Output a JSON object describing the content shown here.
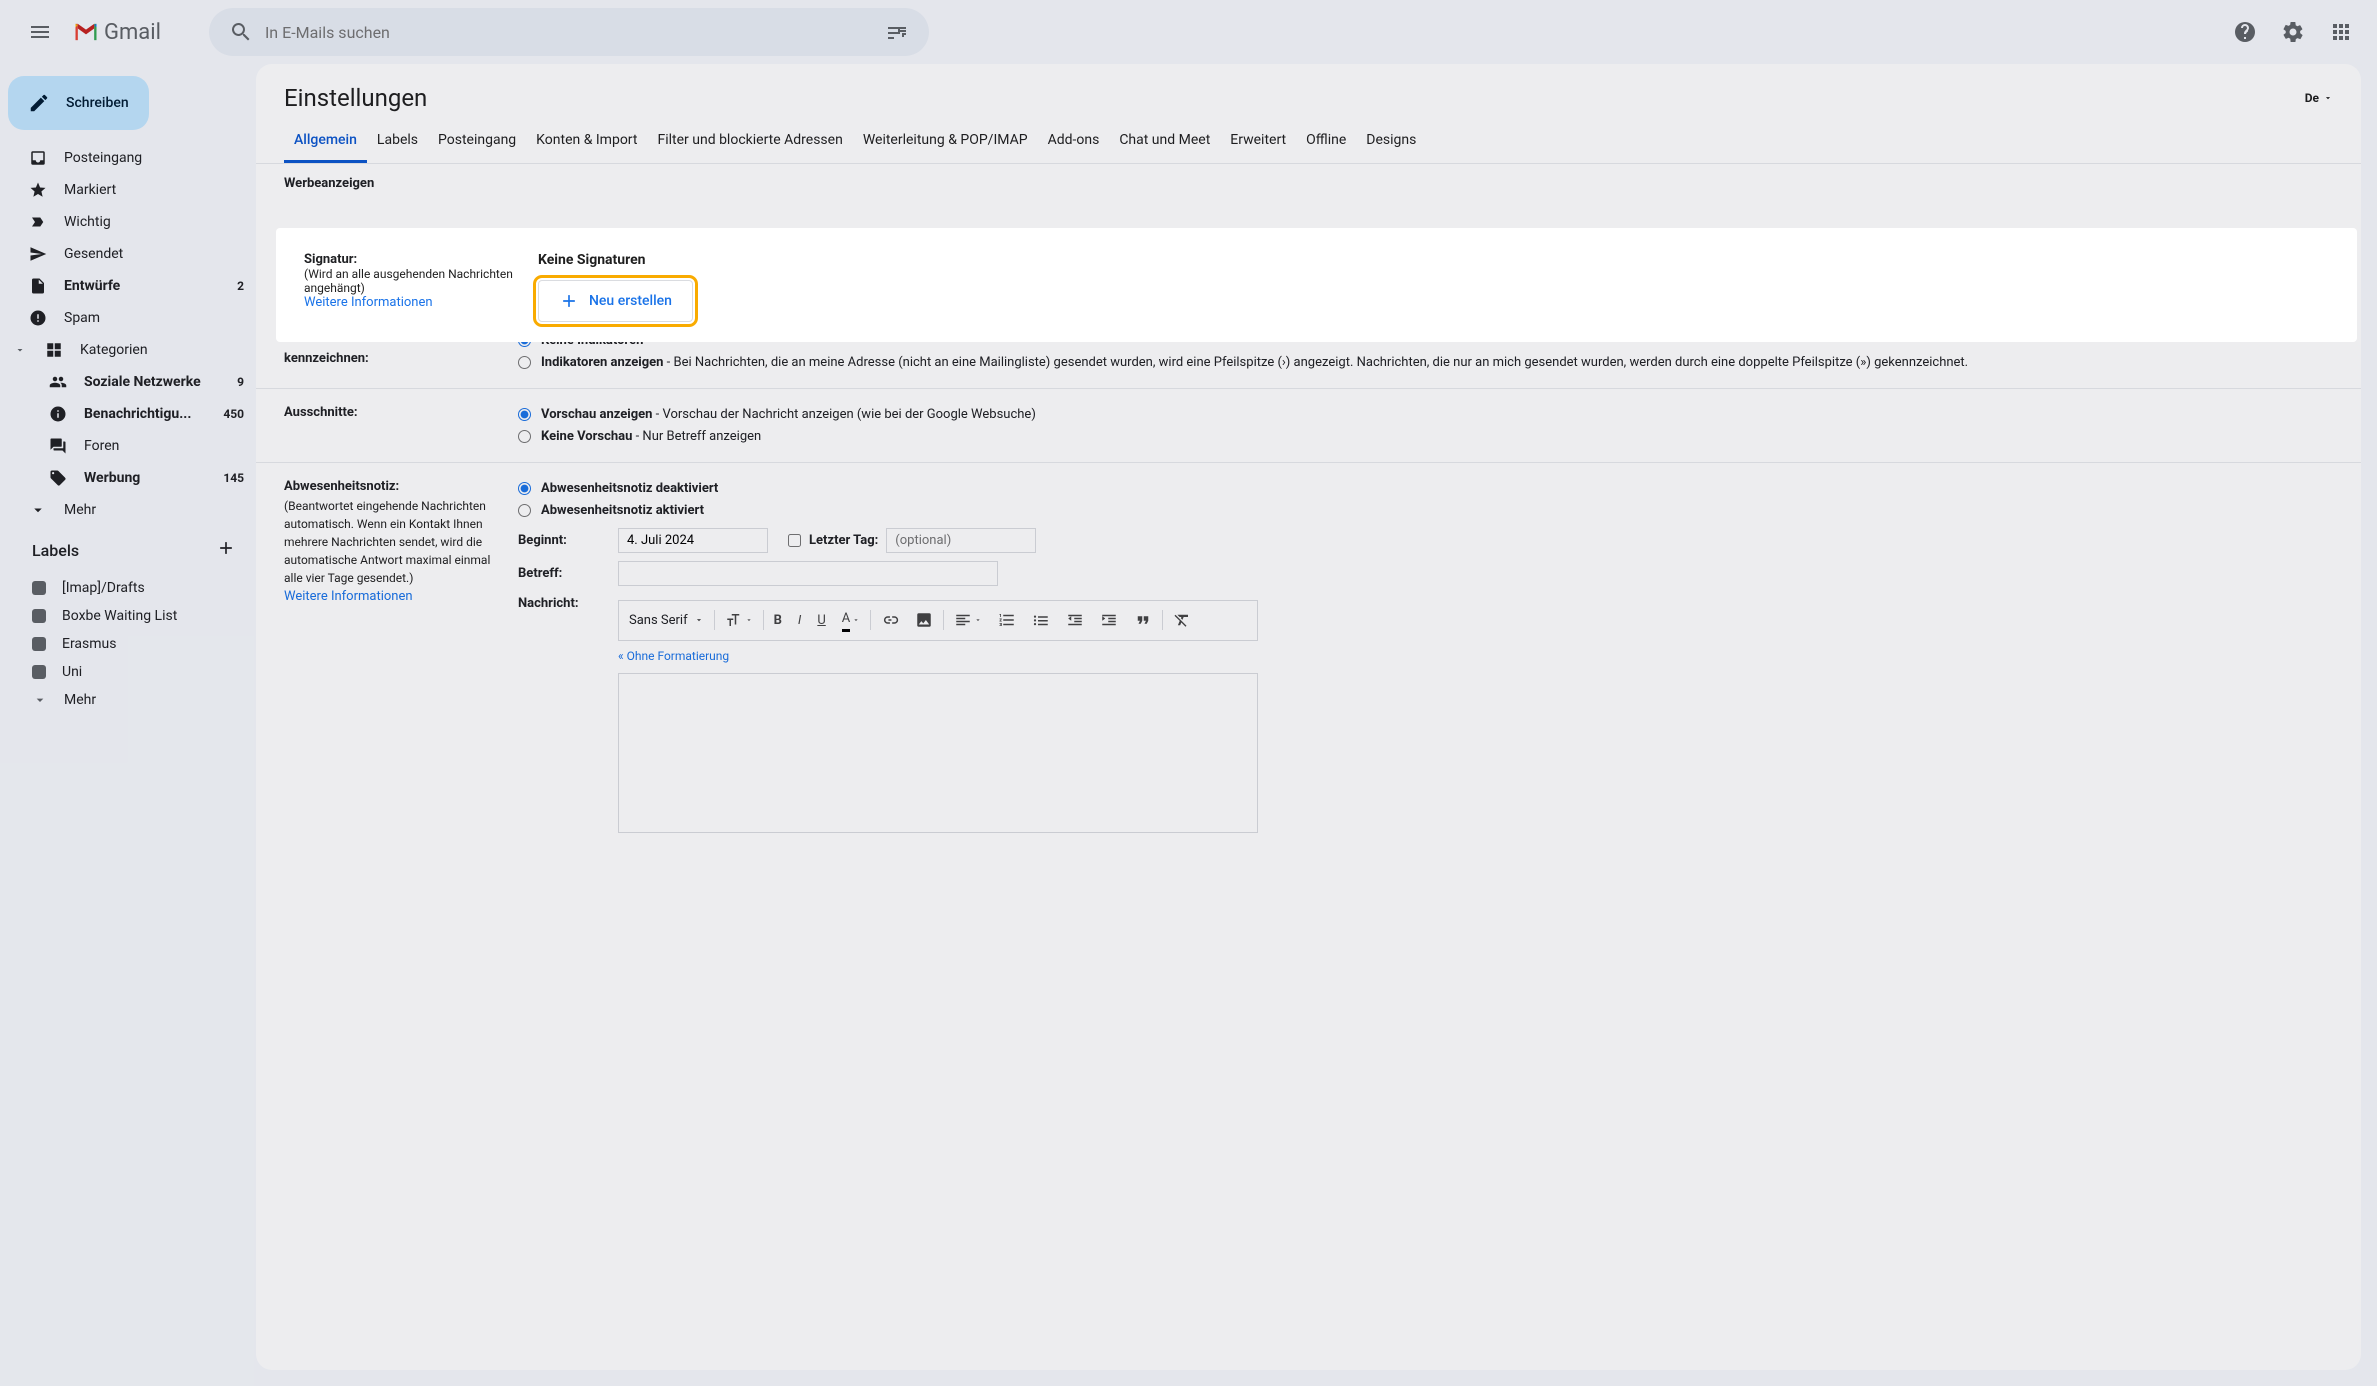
{
  "search": {
    "placeholder": "In E-Mails suchen"
  },
  "compose": {
    "label": "Schreiben"
  },
  "nav": [
    {
      "label": "Posteingang",
      "icon": "inbox",
      "bold": false,
      "count": ""
    },
    {
      "label": "Markiert",
      "icon": "star",
      "bold": false,
      "count": ""
    },
    {
      "label": "Wichtig",
      "icon": "important",
      "bold": false,
      "count": ""
    },
    {
      "label": "Gesendet",
      "icon": "send",
      "bold": false,
      "count": ""
    },
    {
      "label": "Entwürfe",
      "icon": "draft",
      "bold": true,
      "count": "2"
    },
    {
      "label": "Spam",
      "icon": "spam",
      "bold": false,
      "count": ""
    },
    {
      "label": "Kategorien",
      "icon": "categories",
      "bold": false,
      "count": "",
      "expand": true
    },
    {
      "label": "Soziale Netzwerke",
      "icon": "people",
      "bold": true,
      "count": "9",
      "sub": true
    },
    {
      "label": "Benachrichtigu...",
      "icon": "info",
      "bold": true,
      "count": "450",
      "sub": true
    },
    {
      "label": "Foren",
      "icon": "forum",
      "bold": false,
      "count": "",
      "sub": true
    },
    {
      "label": "Werbung",
      "icon": "tag",
      "bold": true,
      "count": "145",
      "sub": true
    },
    {
      "label": "Mehr",
      "icon": "more",
      "bold": false,
      "count": ""
    }
  ],
  "labels": {
    "header": "Labels",
    "items": [
      "[Imap]/Drafts",
      "Boxbe Waiting List",
      "Erasmus",
      "Uni"
    ],
    "more": "Mehr"
  },
  "page": {
    "title": "Einstellungen",
    "lang": "De"
  },
  "tabs": [
    "Allgemein",
    "Labels",
    "Posteingang",
    "Konten & Import",
    "Filter und blockierte Adressen",
    "Weiterleitung & POP/IMAP",
    "Add-ons",
    "Chat und Meet",
    "Erweitert",
    "Offline",
    "Designs"
  ],
  "tabs_active": 0,
  "ads": {
    "header": "Werbeanzeigen"
  },
  "signature": {
    "title": "Signatur:",
    "sub": "(Wird an alle ausgehenden Nachrichten angehängt)",
    "link": "Weitere Informationen",
    "none": "Keine Signaturen",
    "create": "Neu erstellen"
  },
  "indicators": {
    "title": "Persönliche Nachrichten kennzeichnen:",
    "opt0": "Keine Indikatoren",
    "opt1_b": "Indikatoren anzeigen",
    "opt1_rest": " - Bei Nachrichten, die an meine Adresse (nicht an eine Mailingliste) gesendet wurden, wird eine Pfeilspitze (›) angezeigt. Nachrichten, die nur an mich gesendet wurden, werden durch eine doppelte Pfeilspitze (») gekennzeichnet."
  },
  "snippets": {
    "title": "Ausschnitte:",
    "opt0_b": "Vorschau anzeigen",
    "opt0_rest": " - Vorschau der Nachricht anzeigen (wie bei der Google Websuche)",
    "opt1_b": "Keine Vorschau",
    "opt1_rest": " - Nur Betreff anzeigen"
  },
  "vacation": {
    "title": "Abwesenheitsnotiz:",
    "sub": "(Beantwortet eingehende Nachrichten automatisch. Wenn ein Kontakt Ihnen mehrere Nachrichten sendet, wird die automatische Antwort maximal einmal alle vier Tage gesendet.)",
    "link": "Weitere Informationen",
    "off": "Abwesenheitsnotiz deaktiviert",
    "on": "Abwesenheitsnotiz aktiviert",
    "start_label": "Beginnt:",
    "start_value": "4. Juli 2024",
    "end_label": "Letzter Tag:",
    "end_placeholder": "(optional)",
    "subject_label": "Betreff:",
    "message_label": "Nachricht:",
    "font": "Sans Serif",
    "plain": "« Ohne Formatierung"
  }
}
